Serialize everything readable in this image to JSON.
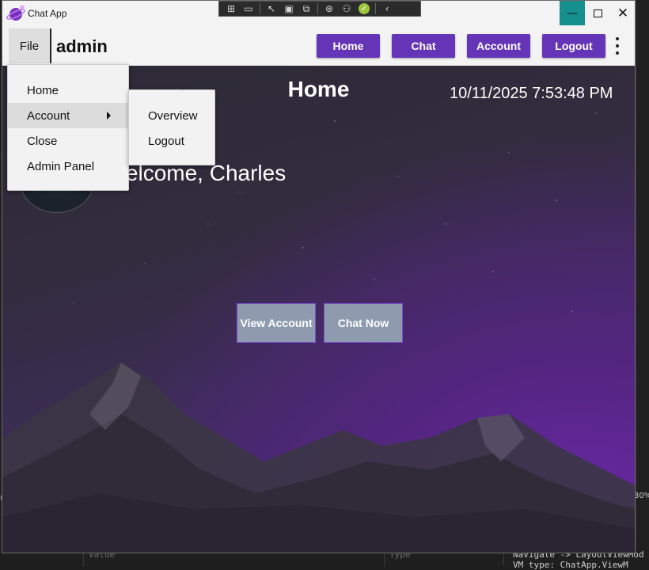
{
  "window": {
    "title": "Chat App",
    "controls": {
      "minimize": "—",
      "close": "✕"
    }
  },
  "header": {
    "file_label": "File",
    "user_label": "admin",
    "nav": [
      "Home",
      "Chat",
      "Account",
      "Logout"
    ]
  },
  "file_menu": {
    "items": [
      "Home",
      "Account",
      "Close",
      "Admin Panel"
    ],
    "highlighted": "Account"
  },
  "account_submenu": {
    "items": [
      "Overview",
      "Logout"
    ]
  },
  "main": {
    "title": "Home",
    "datetime": "10/11/2025 7:53:48 PM",
    "welcome": "Welcome, Charles",
    "buttons": {
      "view_account": "View Account",
      "chat_now": "Chat Now"
    }
  },
  "backdrop": {
    "zoom": "30%",
    "column_value": "Value",
    "column_type": "Type",
    "log_lines": [
      "Navigate -> LayoutViewMod",
      "VM type: ChatApp.ViewM"
    ]
  },
  "colors": {
    "accent": "#6535b8",
    "minimize_hover": "#168f8f",
    "action_button": "#8e9aae"
  }
}
